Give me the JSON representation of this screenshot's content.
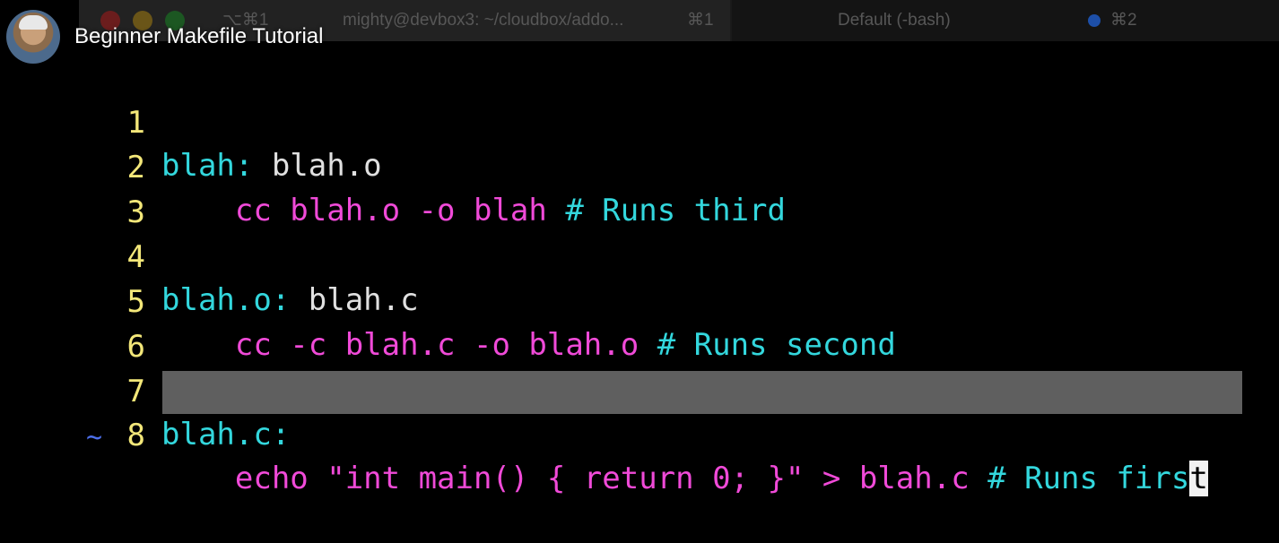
{
  "overlay": {
    "video_title": "Beginner Makefile Tutorial"
  },
  "terminal": {
    "tab_active": {
      "shortcut_left": "⌥⌘1",
      "title": "mighty@devbox3: ~/cloudbox/addo...",
      "shortcut": "⌘1"
    },
    "tab_inactive": {
      "title": "Default (-bash)",
      "shortcut": "⌘2"
    }
  },
  "editor": {
    "lines": [
      {
        "num": "1",
        "target": "blah:",
        "deps": " blah.o",
        "cmd": "",
        "comment": ""
      },
      {
        "num": "2",
        "target": "",
        "deps": "",
        "cmd": "    cc blah.o -o blah ",
        "comment": "# Runs third"
      },
      {
        "num": "3",
        "target": "",
        "deps": "",
        "cmd": "",
        "comment": ""
      },
      {
        "num": "4",
        "target": "blah.o:",
        "deps": " blah.c",
        "cmd": "",
        "comment": ""
      },
      {
        "num": "5",
        "target": "",
        "deps": "",
        "cmd": "    cc -c blah.c -o blah.o ",
        "comment": "# Runs second"
      },
      {
        "num": "6",
        "target": "",
        "deps": "",
        "cmd": "",
        "comment": ""
      },
      {
        "num": "7",
        "target": "blah.c:",
        "deps": "",
        "cmd": "",
        "comment": ""
      },
      {
        "num": "8",
        "target": "",
        "deps": "",
        "cmd": "    echo \"int main() { return 0; }\" > blah.c ",
        "comment": "# Runs firs",
        "cursor_char": "t"
      }
    ],
    "tilde": "~"
  },
  "colors": {
    "line_number": "#f3e779",
    "target": "#33d7dd",
    "command": "#f04ad8",
    "comment": "#33d7dd",
    "highlight": "#5f5f5f"
  }
}
